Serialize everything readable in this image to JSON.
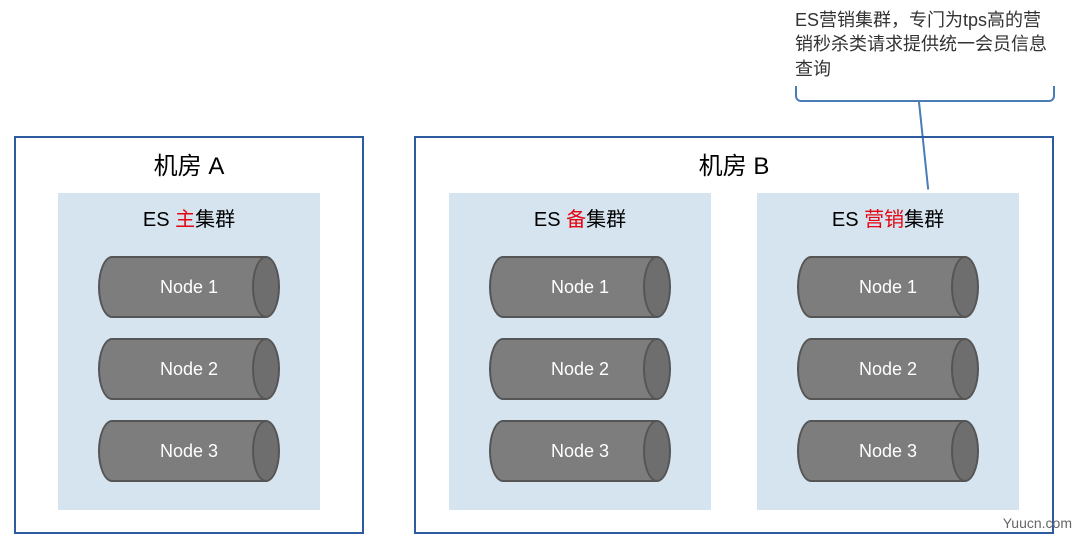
{
  "callout": {
    "text": "ES营销集群，专门为tps高的营销秒杀类请求提供统一会员信息查询"
  },
  "rooms": [
    {
      "title": "机房 A",
      "clusters": [
        {
          "prefix": "ES ",
          "highlight": "主",
          "suffix": "集群",
          "nodes": [
            "Node 1",
            "Node 2",
            "Node 3"
          ]
        }
      ]
    },
    {
      "title": "机房 B",
      "clusters": [
        {
          "prefix": "ES ",
          "highlight": "备",
          "suffix": "集群",
          "nodes": [
            "Node 1",
            "Node 2",
            "Node 3"
          ]
        },
        {
          "prefix": "ES ",
          "highlight": "营销",
          "suffix": "集群",
          "nodes": [
            "Node 1",
            "Node 2",
            "Node 3"
          ]
        }
      ]
    }
  ],
  "watermark": "Yuucn.com"
}
